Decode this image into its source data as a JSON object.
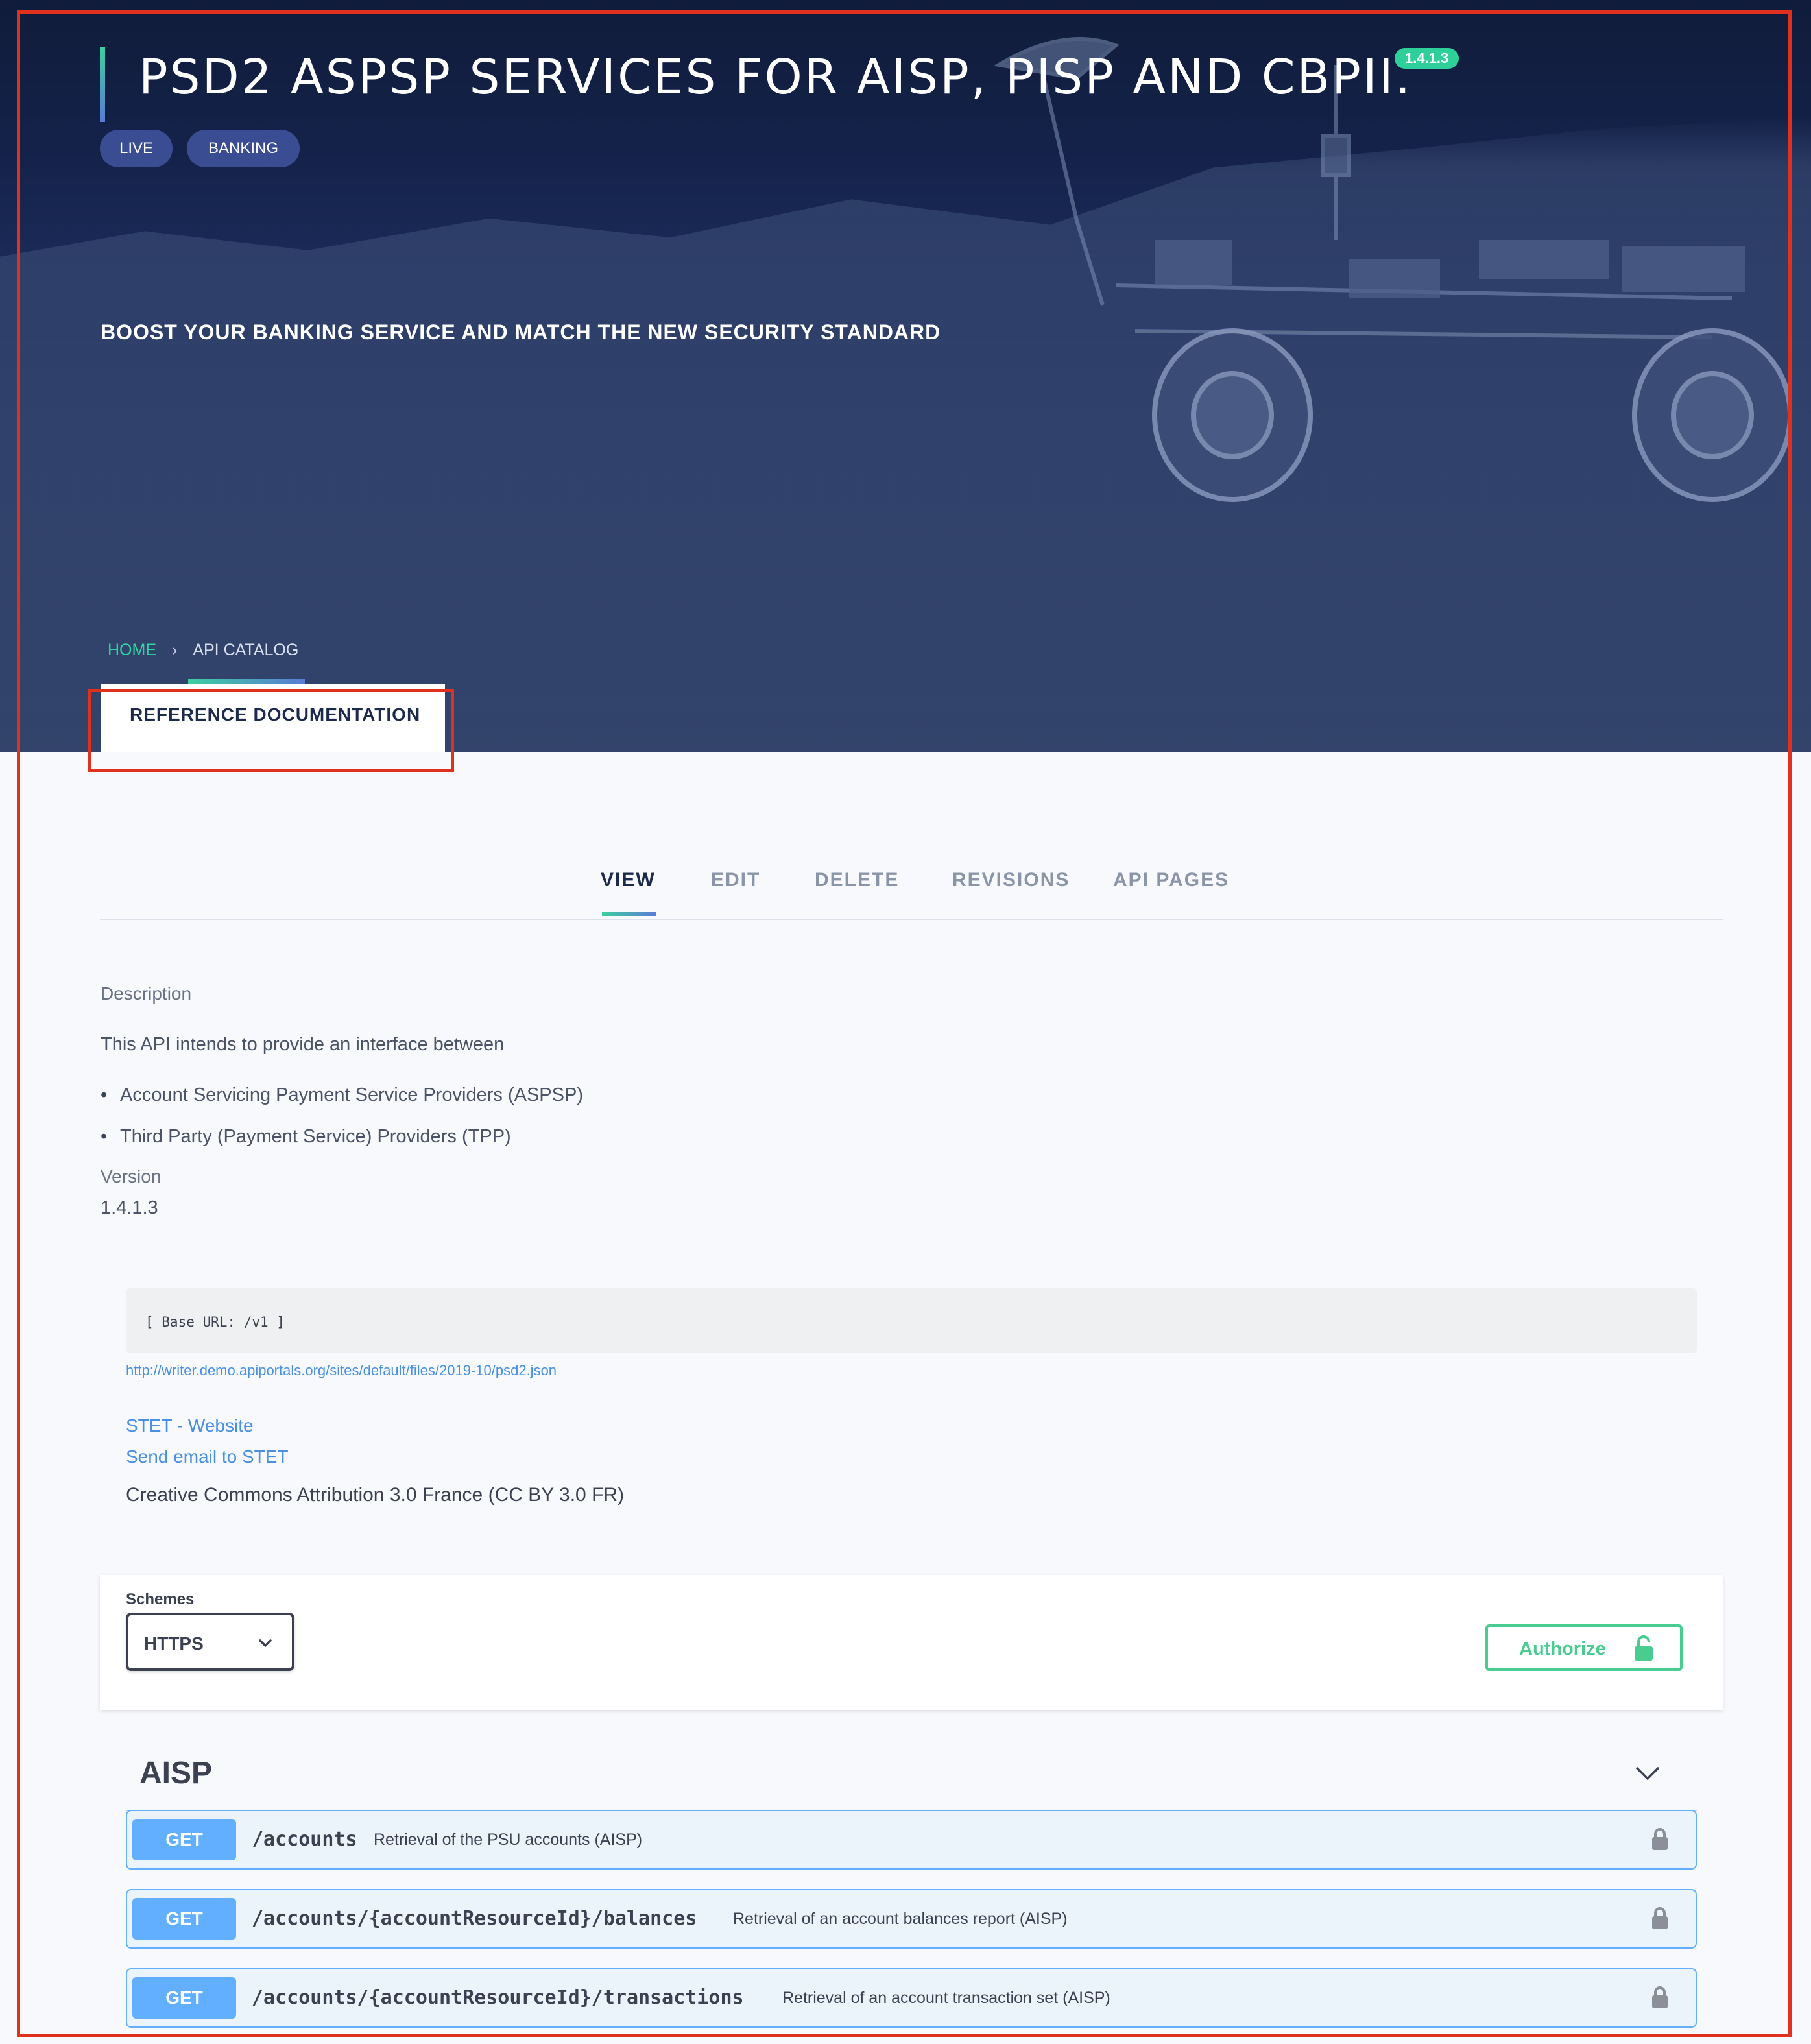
{
  "hero": {
    "title": "PSD2 ASPSP SERVICES FOR AISP, PISP AND CBPII.",
    "version_badge": "1.4.1.3",
    "tags": [
      "LIVE",
      "BANKING"
    ],
    "subtitle": "BOOST YOUR BANKING SERVICE AND MATCH THE NEW SECURITY STANDARD"
  },
  "breadcrumb": {
    "home": "HOME",
    "separator": "›",
    "current": "API CATALOG"
  },
  "reference_tab": {
    "label": "REFERENCE DOCUMENTATION"
  },
  "tabs": [
    {
      "label": "VIEW",
      "active": true
    },
    {
      "label": "EDIT",
      "active": false
    },
    {
      "label": "DELETE",
      "active": false
    },
    {
      "label": "REVISIONS",
      "active": false
    },
    {
      "label": "API PAGES",
      "active": false
    }
  ],
  "description": {
    "label": "Description",
    "intro": "This API intends to provide an interface between",
    "bullets": [
      "Account Servicing Payment Service Providers (ASPSP)",
      "Third Party (Payment Service) Providers (TPP)"
    ],
    "version_label": "Version",
    "version_value": "1.4.1.3"
  },
  "spec": {
    "base_url": "[ Base URL: /v1 ]",
    "spec_url": "http://writer.demo.apiportals.org/sites/default/files/2019-10/psd2.json",
    "website_link": "STET - Website",
    "email_link": "Send email to STET",
    "license": "Creative Commons Attribution 3.0 France (CC BY 3.0 FR)"
  },
  "schemes": {
    "label": "Schemes",
    "selected": "HTTPS",
    "authorize_label": "Authorize"
  },
  "section": {
    "title": "AISP"
  },
  "operations": [
    {
      "method": "GET",
      "path": "/accounts",
      "summary": "Retrieval of the PSU accounts (AISP)"
    },
    {
      "method": "GET",
      "path": "/accounts/{accountResourceId}/balances",
      "summary": "Retrieval of an account balances report (AISP)"
    },
    {
      "method": "GET",
      "path": "/accounts/{accountResourceId}/transactions",
      "summary": "Retrieval of an account transaction set (AISP)"
    }
  ],
  "colors": {
    "hero_bg": "#14224a",
    "accent_green": "#2fcf9a",
    "tag_bg": "#3a4d92",
    "get_blue": "#61affe",
    "authorize_green": "#49cc90",
    "annotation_red": "#e0301e"
  },
  "icons": {
    "breadcrumb_separator": "chevron-right-icon",
    "select_arrow": "chevron-down-icon",
    "authorize": "unlocked-padlock-icon",
    "operation": "padlock-icon",
    "section_toggle": "chevron-down-icon"
  }
}
